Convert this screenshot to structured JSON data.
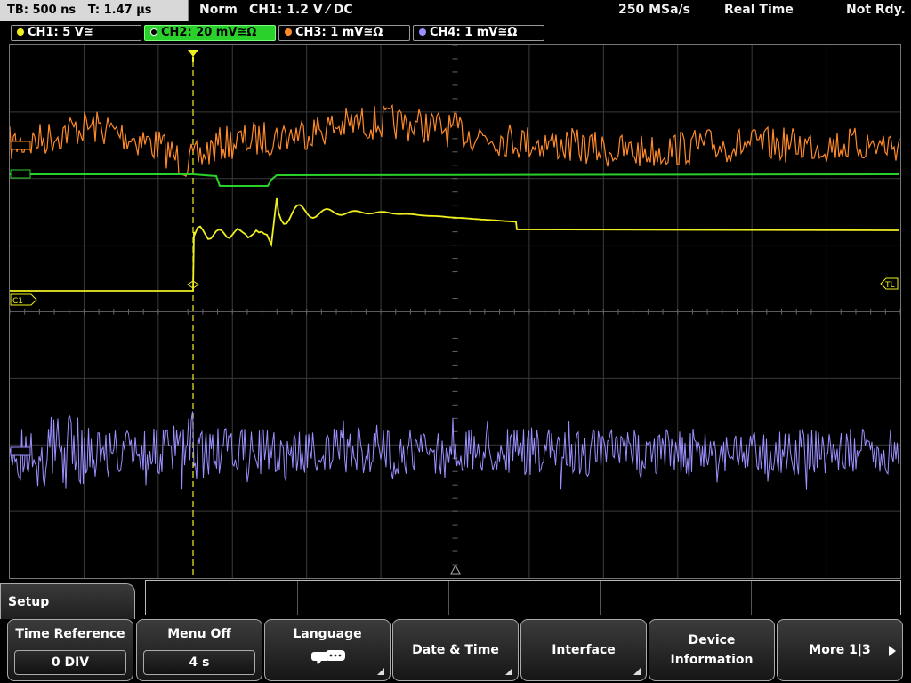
{
  "header": {
    "timebase": "TB: 500 ns",
    "trigger_time": "T: 1.47 µs",
    "mode": "Norm",
    "trigger": "CH1: 1.2 V ⁄ DC",
    "sample_rate": "250 MSa/s",
    "acq_mode": "Real Time",
    "status": "Not Rdy."
  },
  "channels": [
    {
      "label": "CH1: 5 V≅",
      "color": "#f0f020"
    },
    {
      "label": "CH2: 20 mV≅Ω",
      "color": "#2bd12b",
      "active": true
    },
    {
      "label": "CH3: 1 mV≅Ω",
      "color": "#ff8a2a"
    },
    {
      "label": "CH4: 1 mV≅Ω",
      "color": "#9a90ff"
    }
  ],
  "markers": {
    "ch1": "C1",
    "trig_level": "TL"
  },
  "menu": {
    "title": "Setup",
    "time_reference": {
      "label": "Time Reference",
      "value": "0 DIV"
    },
    "menu_off": {
      "label": "Menu Off",
      "value": "4 s"
    },
    "language": {
      "label": "Language"
    },
    "date_time": {
      "label": "Date & Time"
    },
    "interface": {
      "label": "Interface"
    },
    "device_info": {
      "label1": "Device",
      "label2": "Information"
    },
    "more": {
      "label": "More 1|3"
    }
  }
}
